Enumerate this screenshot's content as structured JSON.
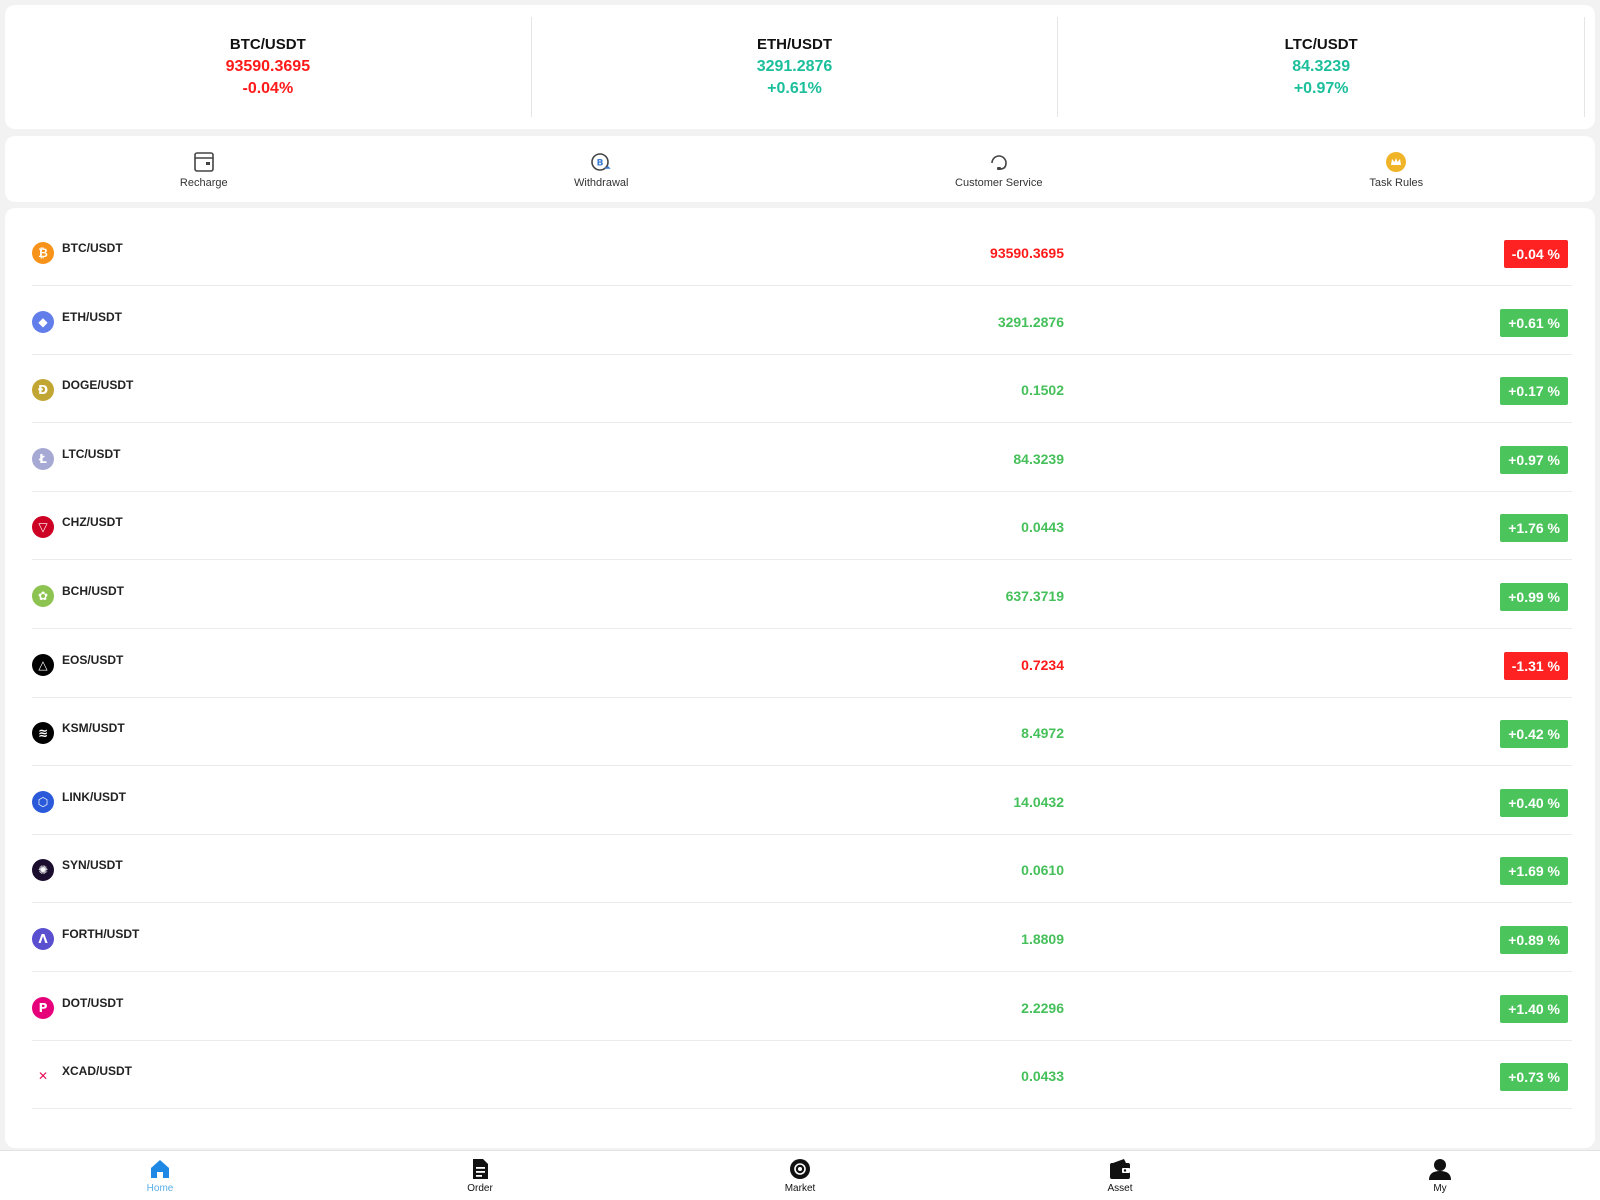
{
  "tickers": [
    {
      "pair": "BTC/USDT",
      "price": "93590.3695",
      "change": "-0.04%",
      "trend": "down"
    },
    {
      "pair": "ETH/USDT",
      "price": "3291.2876",
      "change": "+0.61%",
      "trend": "up"
    },
    {
      "pair": "LTC/USDT",
      "price": "84.3239",
      "change": "+0.97%",
      "trend": "up"
    }
  ],
  "actions": {
    "recharge": "Recharge",
    "withdrawal": "Withdrawal",
    "customer_service": "Customer Service",
    "task_rules": "Task Rules"
  },
  "market": [
    {
      "symbol": "BTC/USDT",
      "price": "93590.3695",
      "change": "-0.04 %",
      "trend": "down",
      "icon": "btc-icon",
      "color": "#f7931a"
    },
    {
      "symbol": "ETH/USDT",
      "price": "3291.2876",
      "change": "+0.61 %",
      "trend": "up",
      "icon": "eth-icon",
      "color": "#627eea"
    },
    {
      "symbol": "DOGE/USDT",
      "price": "0.1502",
      "change": "+0.17 %",
      "trend": "up",
      "icon": "doge-icon",
      "color": "#c2a633"
    },
    {
      "symbol": "LTC/USDT",
      "price": "84.3239",
      "change": "+0.97 %",
      "trend": "up",
      "icon": "ltc-icon",
      "color": "#a6a9d4"
    },
    {
      "symbol": "CHZ/USDT",
      "price": "0.0443",
      "change": "+1.76 %",
      "trend": "up",
      "icon": "chz-icon",
      "color": "#cd0124"
    },
    {
      "symbol": "BCH/USDT",
      "price": "637.3719",
      "change": "+0.99 %",
      "trend": "up",
      "icon": "bch-icon",
      "color": "#8dc351"
    },
    {
      "symbol": "EOS/USDT",
      "price": "0.7234",
      "change": "-1.31 %",
      "trend": "down",
      "icon": "eos-icon",
      "color": "#000000"
    },
    {
      "symbol": "KSM/USDT",
      "price": "8.4972",
      "change": "+0.42 %",
      "trend": "up",
      "icon": "ksm-icon",
      "color": "#000000"
    },
    {
      "symbol": "LINK/USDT",
      "price": "14.0432",
      "change": "+0.40 %",
      "trend": "up",
      "icon": "link-icon",
      "color": "#2a5ada"
    },
    {
      "symbol": "SYN/USDT",
      "price": "0.0610",
      "change": "+1.69 %",
      "trend": "up",
      "icon": "syn-icon",
      "color": "#1a0d2e"
    },
    {
      "symbol": "FORTH/USDT",
      "price": "1.8809",
      "change": "+0.89 %",
      "trend": "up",
      "icon": "forth-icon",
      "color": "#5a4fcf"
    },
    {
      "symbol": "DOT/USDT",
      "price": "2.2296",
      "change": "+1.40 %",
      "trend": "up",
      "icon": "dot-icon",
      "color": "#e6007a"
    },
    {
      "symbol": "XCAD/USDT",
      "price": "0.0433",
      "change": "+0.73 %",
      "trend": "up",
      "icon": "xcad-icon",
      "color": "#e8115b"
    }
  ],
  "tabs": {
    "home": "Home",
    "order": "Order",
    "market": "Market",
    "asset": "Asset",
    "my": "My"
  },
  "colors": {
    "up": "#45c05a",
    "down": "#ff1a1a",
    "teal": "#1cbf9b",
    "active_tab": "#5aaee8"
  }
}
